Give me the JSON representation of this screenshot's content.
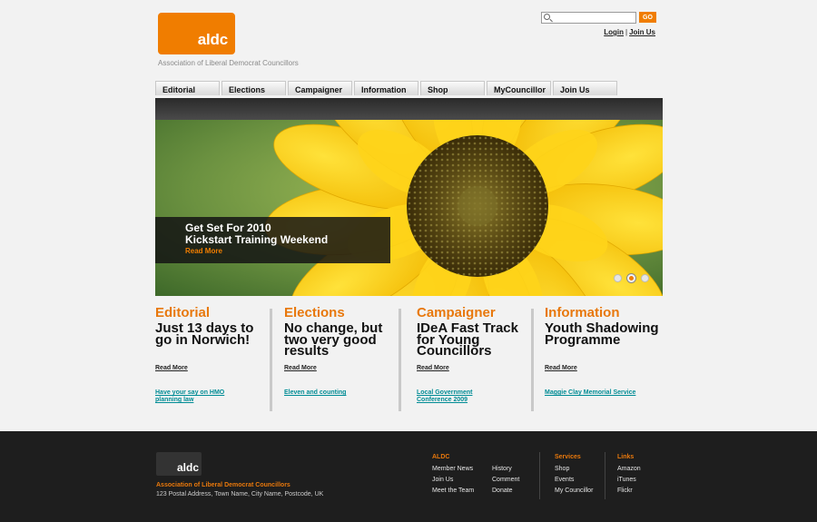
{
  "header": {
    "logo_text": "aldc",
    "org_name": "Association of Liberal Democrat Councillors",
    "search_placeholder": "",
    "go_label": "GO",
    "login_label": "Login",
    "separator": "|",
    "join_label": "Join Us"
  },
  "nav": {
    "tabs": [
      "Editorial",
      "Elections",
      "Campaigner",
      "Information",
      "Shop",
      "MyCouncillor",
      "Join Us"
    ]
  },
  "hero": {
    "title_line1": "Get Set For 2010",
    "title_line2": "Kickstart Training Weekend",
    "read_more": "Read More",
    "slide_count": 3,
    "active_slide": 2
  },
  "columns": [
    {
      "category": "Editorial",
      "headline": "Just 13 days to go in Norwich!",
      "read_more": "Read More",
      "sub_link": "Have your say on HMO\nplanning law"
    },
    {
      "category": "Elections",
      "headline": "No change, but two very good results",
      "read_more": "Read More",
      "sub_link": "Eleven and counting"
    },
    {
      "category": "Campaigner",
      "headline": "IDeA Fast Track for Young Councillors",
      "read_more": "Read More",
      "sub_link": "Local Government\nConference 2009"
    },
    {
      "category": "Information",
      "headline": "Youth Shadowing Programme",
      "read_more": "Read More",
      "sub_link": "Maggie Clay Memorial Service"
    }
  ],
  "footer": {
    "logo_text": "aldc",
    "org_name": "Association of Liberal Democrat Councillors",
    "address": "123 Postal Address, Town Name, City Name, Postcode, UK",
    "aldc_heading": "ALDC",
    "aldc_col1": [
      "Member News",
      "Join Us",
      "Meet the Team"
    ],
    "aldc_col2": [
      "History",
      "Comment",
      "Donate"
    ],
    "services_heading": "Services",
    "services": [
      "Shop",
      "Events",
      "My Councillor"
    ],
    "links_heading": "Links",
    "links": [
      "Amazon",
      "iTunes",
      "Flickr"
    ]
  },
  "colors": {
    "accent": "#f07d00",
    "link_teal": "#008c95",
    "footer_bg": "#1e1e1e"
  }
}
